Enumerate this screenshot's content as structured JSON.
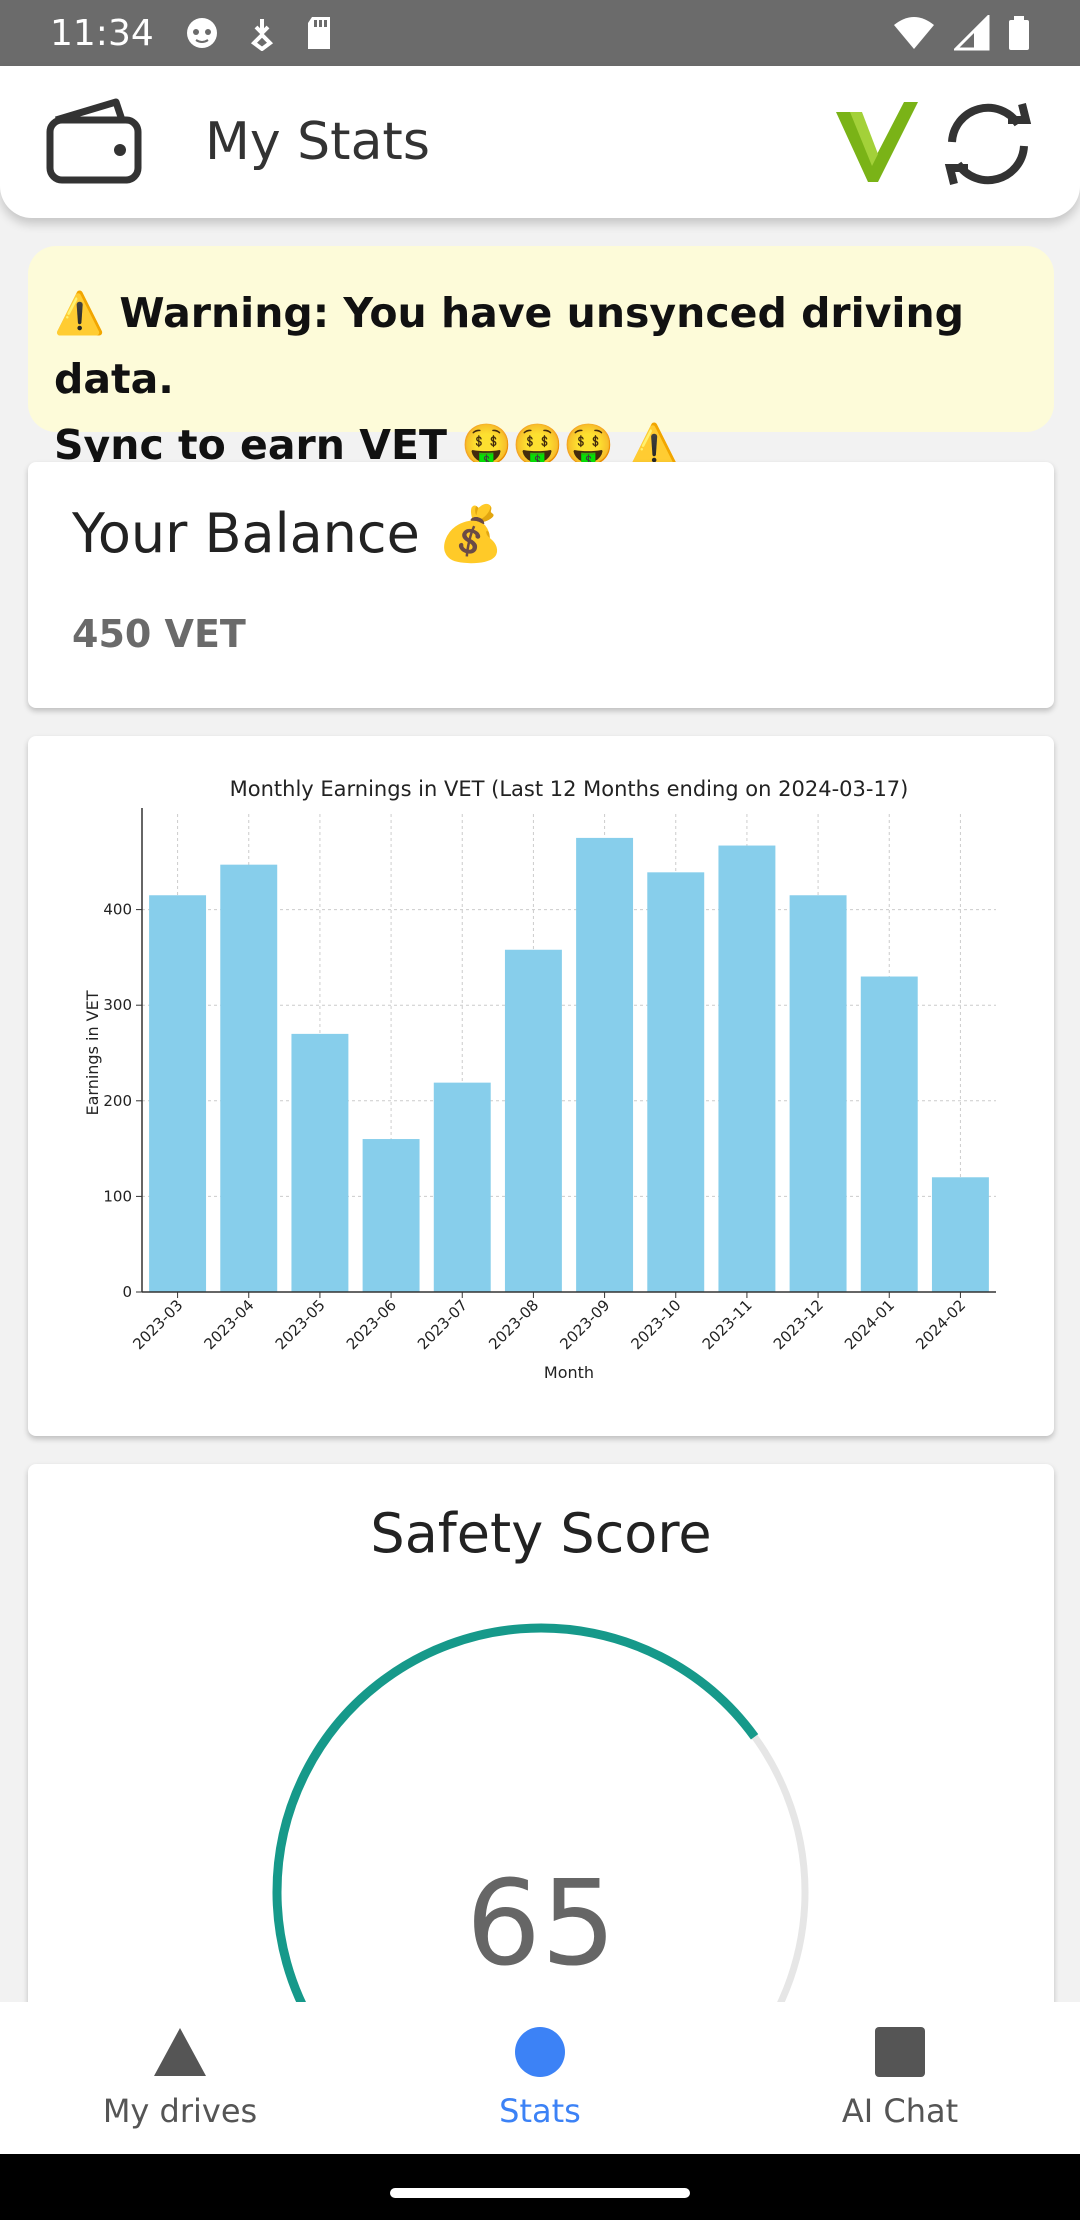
{
  "status_bar": {
    "time": "11:34",
    "icons_left": [
      "cat-icon",
      "download-icon",
      "sd-card-icon"
    ],
    "icons_right": [
      "wifi-icon",
      "signal-icon",
      "battery-icon"
    ]
  },
  "app_bar": {
    "title": "My Stats",
    "left_icon": "wallet-icon",
    "right_icons": [
      "vechain-logo",
      "sync-icon"
    ],
    "logo_color": "#7ab317"
  },
  "warning": {
    "line1": "⚠️ Warning: You have unsynced driving data.",
    "line2": "Sync to earn VET 🤑🤑🤑 ⚠️"
  },
  "balance": {
    "title": "Your Balance 💰",
    "value": "450 VET"
  },
  "chart_data": {
    "type": "bar",
    "title": "Monthly Earnings in VET (Last 12 Months ending on 2024-03-17)",
    "xlabel": "Month",
    "ylabel": "Earnings in VET",
    "categories": [
      "2023-03",
      "2023-04",
      "2023-05",
      "2023-06",
      "2023-07",
      "2023-08",
      "2023-09",
      "2023-10",
      "2023-11",
      "2023-12",
      "2024-01",
      "2024-02"
    ],
    "values": [
      415,
      447,
      270,
      160,
      219,
      358,
      475,
      439,
      467,
      415,
      330,
      120
    ],
    "ylim": [
      0,
      500
    ],
    "yticks": [
      0,
      100,
      200,
      300,
      400
    ],
    "grid": true,
    "bar_color": "#87ceeb"
  },
  "safety": {
    "title": "Safety Score",
    "score": "65",
    "score_fraction": 0.65,
    "track_color": "#e6e6e6",
    "progress_color": "#16998a"
  },
  "bottom_nav": {
    "items": [
      {
        "label": "My drives",
        "icon": "triangle-icon"
      },
      {
        "label": "Stats",
        "icon": "circle-icon"
      },
      {
        "label": "AI Chat",
        "icon": "square-icon"
      }
    ],
    "active": "Stats",
    "active_color": "#3c82f6"
  }
}
